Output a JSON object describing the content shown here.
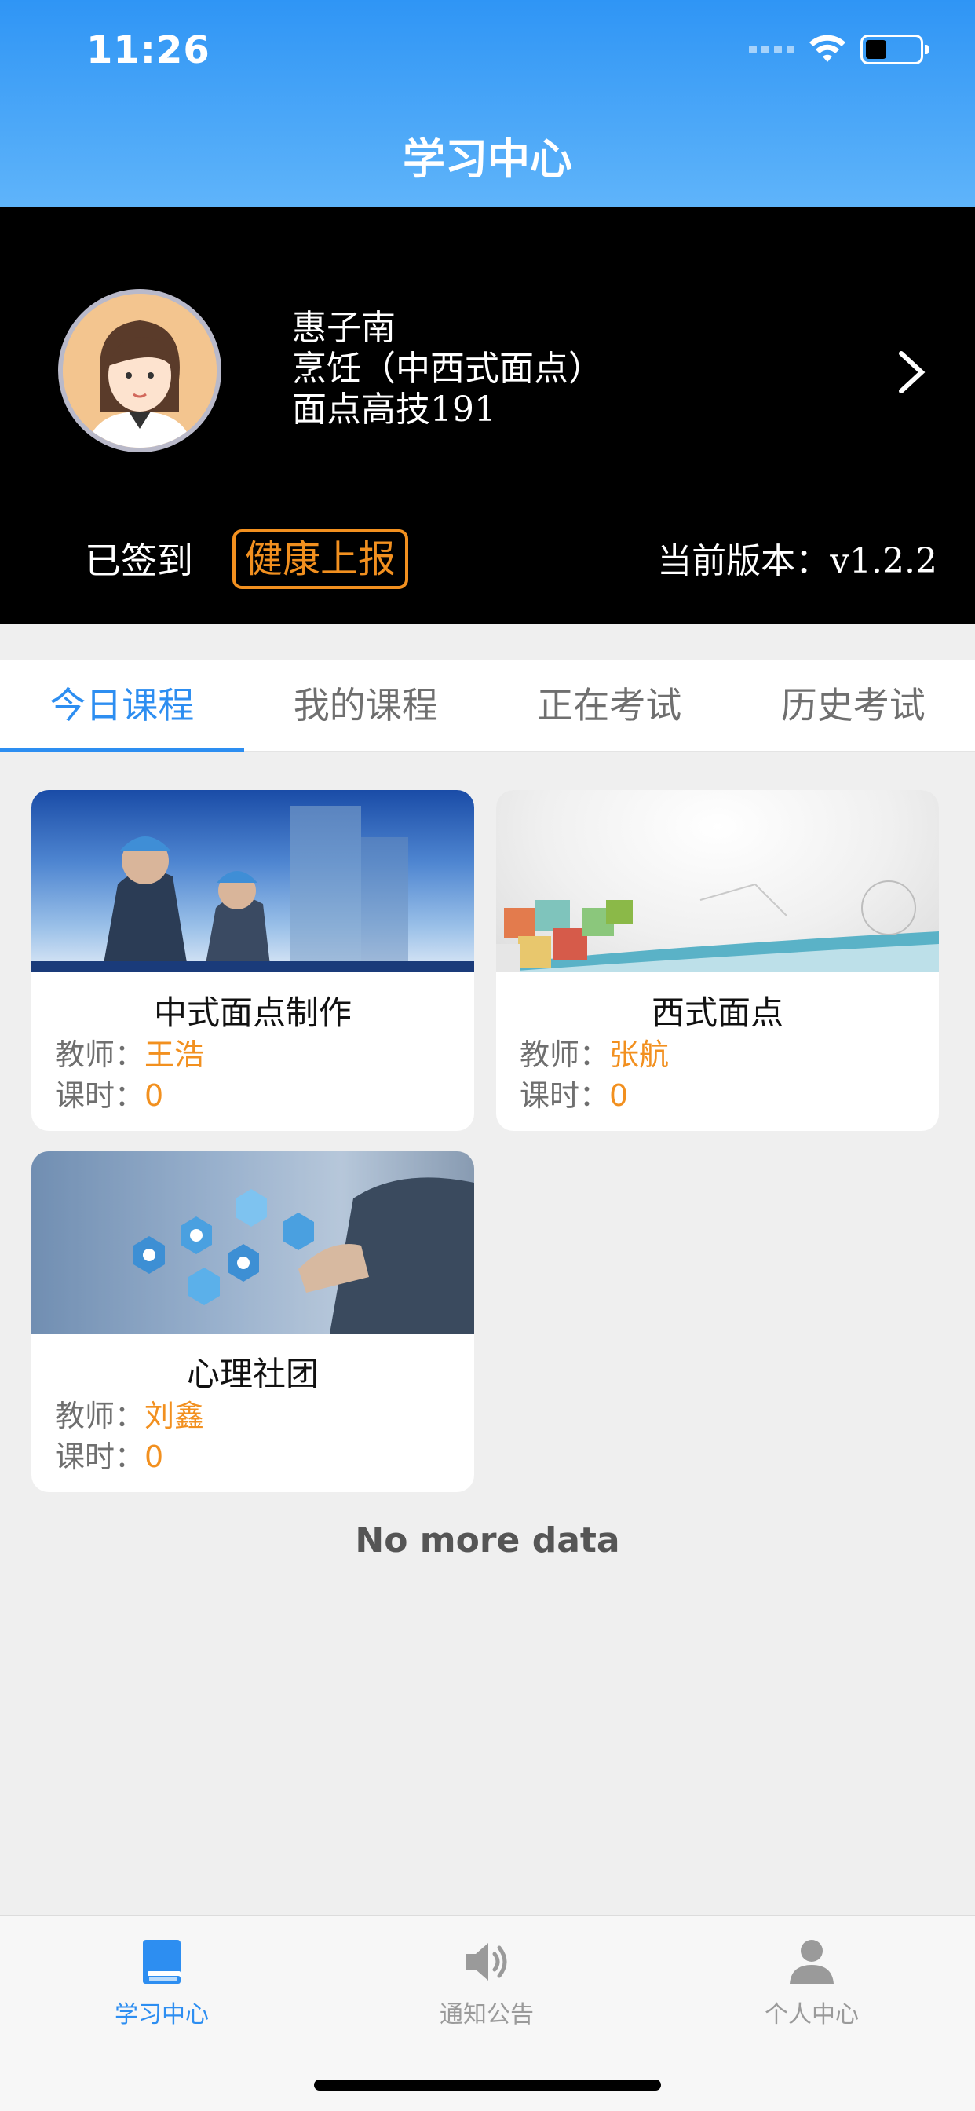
{
  "status_bar": {
    "time": "11:26"
  },
  "nav": {
    "title": "学习中心"
  },
  "profile": {
    "name": "惠子南",
    "major": "烹饪（中西式面点）",
    "class": "面点高技191",
    "signed_text": "已签到",
    "health_button": "健康上报",
    "version_label": "当前版本：",
    "version_value": "v1.2.2"
  },
  "tabs": [
    {
      "label": "今日课程",
      "active": true
    },
    {
      "label": "我的课程",
      "active": false
    },
    {
      "label": "正在考试",
      "active": false
    },
    {
      "label": "历史考试",
      "active": false
    }
  ],
  "courses": [
    {
      "title": "中式面点制作",
      "teacher_label": "教师：",
      "teacher": "王浩",
      "hours_label": "课时：",
      "hours": "0"
    },
    {
      "title": "西式面点",
      "teacher_label": "教师：",
      "teacher": "张航",
      "hours_label": "课时：",
      "hours": "0"
    },
    {
      "title": "心理社团",
      "teacher_label": "教师：",
      "teacher": "刘鑫",
      "hours_label": "课时：",
      "hours": "0"
    }
  ],
  "list_footer": "No more data",
  "tabbar": [
    {
      "label": "学习中心",
      "icon": "book-icon",
      "active": true
    },
    {
      "label": "通知公告",
      "icon": "speaker-icon",
      "active": false
    },
    {
      "label": "个人中心",
      "icon": "person-icon",
      "active": false
    }
  ],
  "colors": {
    "accent": "#2d8ef1",
    "highlight": "#f2901f",
    "header_bg": "#3a9cf6"
  }
}
